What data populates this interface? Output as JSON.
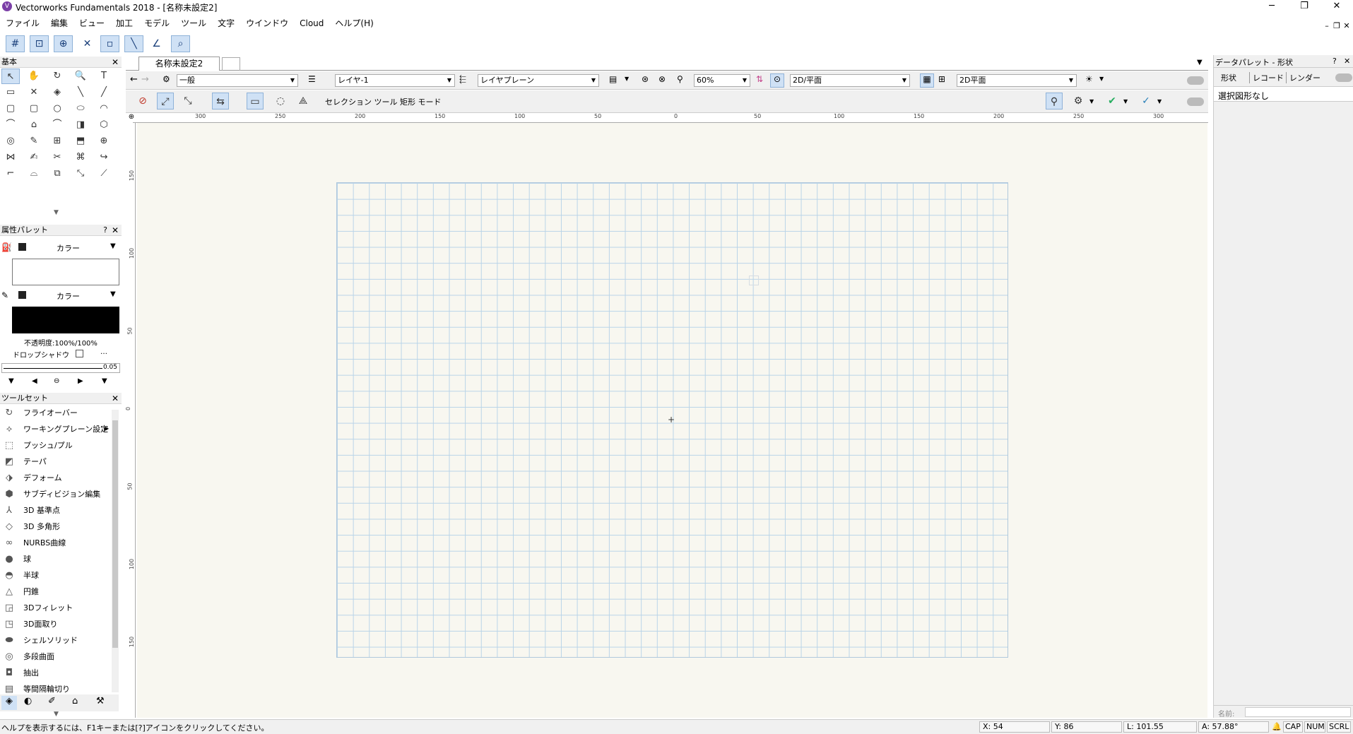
{
  "window": {
    "title": "Vectorworks Fundamentals 2018 - [名称未設定2]",
    "app_icon": "V",
    "minimize": "─",
    "restore": "❐",
    "close": "✕"
  },
  "menu": [
    "ファイル",
    "編集",
    "ビュー",
    "加工",
    "モデル",
    "ツール",
    "文字",
    "ウインドウ",
    "Cloud",
    "ヘルプ(H)"
  ],
  "mdi": {
    "minimize": "–",
    "restore": "❐",
    "close": "✕"
  },
  "snap_icons": [
    "grid-snap-icon",
    "box-snap-icon",
    "object-snap-icon",
    "intersection-snap-icon",
    "tangent-snap-icon",
    "surface-snap-icon",
    "angle-snap-icon",
    "smart-edge-icon"
  ],
  "basic_palette": {
    "title": "基本",
    "close": "✕",
    "tools": [
      "↖",
      "✋",
      "↻",
      "🔍",
      "T",
      "▭",
      "✕",
      "◈",
      "╲",
      "╱",
      "▢",
      "▢",
      "○",
      "⬭",
      "◠",
      "⌒",
      "⌂",
      "⌒",
      "◨",
      "⬡",
      "◎",
      "✎",
      "⊞",
      "⬒",
      "⊕",
      "⋈",
      "✍",
      "✂",
      "⌘",
      "↪",
      "⌐",
      "⌓",
      "⧉",
      "⤡",
      "⟋"
    ]
  },
  "attributes": {
    "title": "属性パレット",
    "help": "?",
    "close": "✕",
    "fill_label": "カラー",
    "pen_label": "カラー",
    "opacity": "不透明度:100%/100%",
    "drop_shadow": "ドロップシャドウ",
    "line_weight": "0.05",
    "ellipsis": "…"
  },
  "toolset": {
    "title": "ツールセット",
    "close": "✕",
    "items": [
      {
        "label": "フライオーバー",
        "icon": "flyover-icon",
        "glyph": "↻"
      },
      {
        "label": "ワーキングプレーン設定",
        "icon": "working-plane-icon",
        "glyph": "⟡"
      },
      {
        "label": "プッシュ/プル",
        "icon": "push-pull-icon",
        "glyph": "⬚"
      },
      {
        "label": "テーパ",
        "icon": "taper-icon",
        "glyph": "◩"
      },
      {
        "label": "デフォーム",
        "icon": "deform-icon",
        "glyph": "⬗"
      },
      {
        "label": "サブディビジョン編集",
        "icon": "subdivision-icon",
        "glyph": "⬢"
      },
      {
        "label": "3D 基準点",
        "icon": "3d-locus-icon",
        "glyph": "⅄"
      },
      {
        "label": "3D 多角形",
        "icon": "3d-polygon-icon",
        "glyph": "◇"
      },
      {
        "label": "NURBS曲線",
        "icon": "nurbs-curve-icon",
        "glyph": "∞"
      },
      {
        "label": "球",
        "icon": "sphere-icon",
        "glyph": "●"
      },
      {
        "label": "半球",
        "icon": "hemisphere-icon",
        "glyph": "◓"
      },
      {
        "label": "円錐",
        "icon": "cone-icon",
        "glyph": "△"
      },
      {
        "label": "3Dフィレット",
        "icon": "3d-fillet-icon",
        "glyph": "◲"
      },
      {
        "label": "3D面取り",
        "icon": "3d-chamfer-icon",
        "glyph": "◳"
      },
      {
        "label": "シェルソリッド",
        "icon": "shell-solid-icon",
        "glyph": "⬬"
      },
      {
        "label": "多段曲面",
        "icon": "loft-surface-icon",
        "glyph": "◎"
      },
      {
        "label": "抽出",
        "icon": "extract-icon",
        "glyph": "◘"
      },
      {
        "label": "等間隔輪切り",
        "icon": "contour-icon",
        "glyph": "▤"
      }
    ]
  },
  "document": {
    "tab": "名称未設定2"
  },
  "view_bar": {
    "class": "一般",
    "layer": "レイヤ-1",
    "layer_plane": "レイヤプレーン",
    "zoom": "60%",
    "view": "2D/平面",
    "render": "2D平面"
  },
  "mode_bar": {
    "mode_text": "セレクション ツール 矩形 モード"
  },
  "ruler": {
    "h_ticks": [
      "300",
      "250",
      "200",
      "150",
      "100",
      "50",
      "0",
      "50",
      "100",
      "150",
      "200",
      "250",
      "300"
    ],
    "v_ticks": [
      "150",
      "100",
      "50",
      "0",
      "50",
      "100",
      "150"
    ]
  },
  "data_palette": {
    "title": "データパレット - 形状",
    "help": "?",
    "close": "✕",
    "tabs": [
      "形状",
      "レコード",
      "レンダー"
    ],
    "status": "選択図形なし",
    "name_label": "名前:"
  },
  "status": {
    "help": "ヘルプを表示するには、F1キーまたは[?]アイコンをクリックしてください。",
    "x": "X: 54",
    "y": "Y: 86",
    "l": "L: 101.55",
    "a": "A: 57.88°",
    "caps": "CAP",
    "num": "NUM",
    "scrl": "SCRL"
  },
  "colors": {
    "accent": "#cfe1f5",
    "grid": "#b9d4e8",
    "canvas": "#f8f7f0"
  }
}
